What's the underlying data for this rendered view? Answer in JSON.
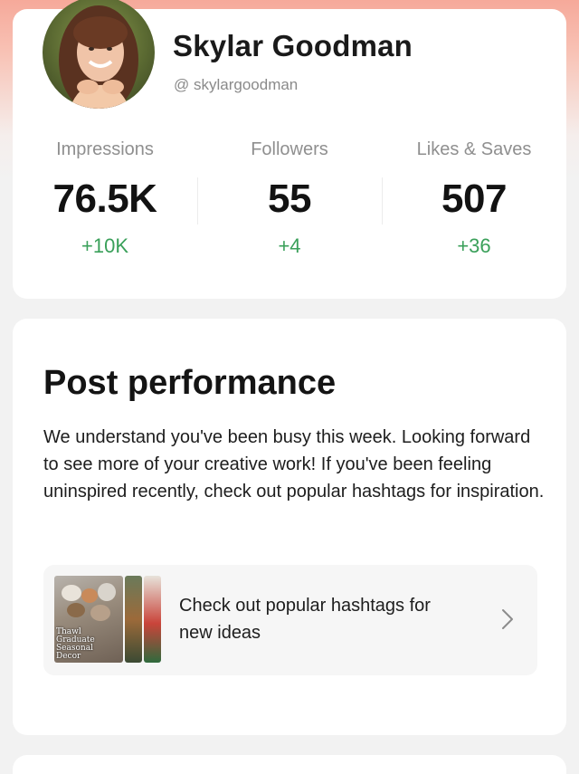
{
  "profile": {
    "name": "Skylar Goodman",
    "handle": "@ skylargoodman",
    "stats": [
      {
        "label": "Impressions",
        "value": "76.5K",
        "delta": "+10K"
      },
      {
        "label": "Followers",
        "value": "55",
        "delta": "+4"
      },
      {
        "label": "Likes & Saves",
        "value": "507",
        "delta": "+36"
      }
    ]
  },
  "performance": {
    "title": "Post performance",
    "message": "We understand you've been busy this week. Looking forward to see more of your creative work! If you've been feeling uninspired recently, check out popular hashtags for inspiration.",
    "hashtag_prompt": "Check out popular hashtags for new ideas",
    "thumbnail_caption": "Thawl Graduate Seasonal Decor"
  },
  "icons": {
    "chevron": "chevron-right-icon",
    "avatar": "profile-photo"
  },
  "colors": {
    "delta_positive": "#3aa05a",
    "header_gradient": "#f6a99a"
  }
}
